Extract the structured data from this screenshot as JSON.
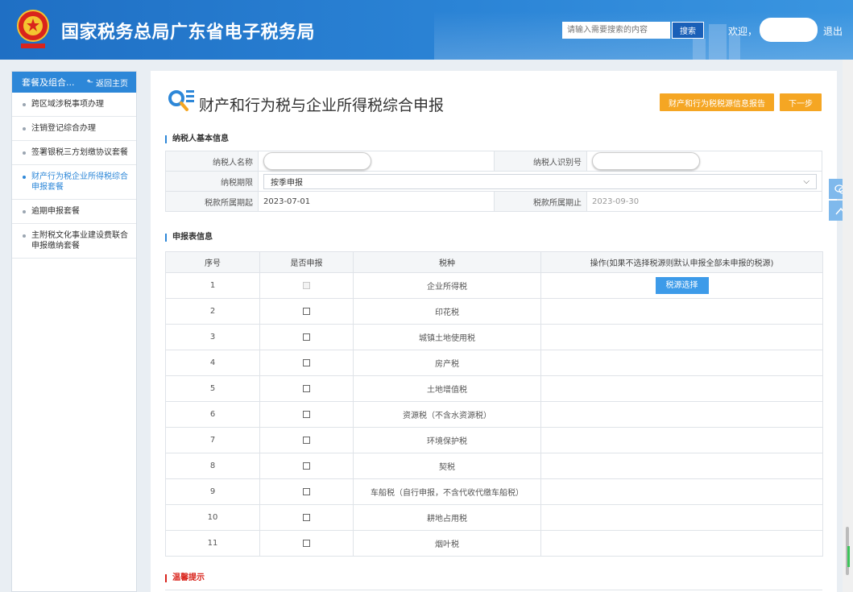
{
  "header": {
    "site_title": "国家税务总局广东省电子税务局",
    "search_placeholder": "请输入需要搜索的内容",
    "search_label": "搜索",
    "welcome": "欢迎，",
    "logout": "退出"
  },
  "sidebar": {
    "title": "套餐及组合...",
    "back_label": "返回主页",
    "items": [
      {
        "label": "跨区域涉税事项办理"
      },
      {
        "label": "注销登记综合办理"
      },
      {
        "label": "签署银税三方划缴协议套餐"
      },
      {
        "label": "财产行为税企业所得税综合申报套餐"
      },
      {
        "label": "逾期申报套餐"
      },
      {
        "label": "主附税文化事业建设费联合申报缴纳套餐"
      }
    ]
  },
  "page": {
    "title": "财产和行为税与企业所得税综合申报",
    "report_button": "财产和行为税税源信息报告",
    "next_button": "下一步"
  },
  "basic_info": {
    "section_title": "纳税人基本信息",
    "name_label": "纳税人名称",
    "id_label": "纳税人识别号",
    "period_label": "纳税期限",
    "period_value": "按季申报",
    "start_label": "税款所属期起",
    "start_value": "2023-07-01",
    "end_label": "税款所属期止",
    "end_value": "2023-09-30"
  },
  "declaration": {
    "section_title": "申报表信息",
    "headers": [
      "序号",
      "是否申报",
      "税种",
      "操作(如果不选择税源则默认申报全部未申报的税源)"
    ],
    "source_button": "税源选择",
    "rows": [
      {
        "no": "1",
        "tax": "企业所得税"
      },
      {
        "no": "2",
        "tax": "印花税"
      },
      {
        "no": "3",
        "tax": "城镇土地使用税"
      },
      {
        "no": "4",
        "tax": "房产税"
      },
      {
        "no": "5",
        "tax": "土地增值税"
      },
      {
        "no": "6",
        "tax": "资源税（不含水资源税）"
      },
      {
        "no": "7",
        "tax": "环境保护税"
      },
      {
        "no": "8",
        "tax": "契税"
      },
      {
        "no": "9",
        "tax": "车船税（自行申报，不含代收代缴车船税）"
      },
      {
        "no": "10",
        "tax": "耕地占用税"
      },
      {
        "no": "11",
        "tax": "烟叶税"
      }
    ]
  },
  "tips": {
    "section_title": "温馨提示"
  }
}
